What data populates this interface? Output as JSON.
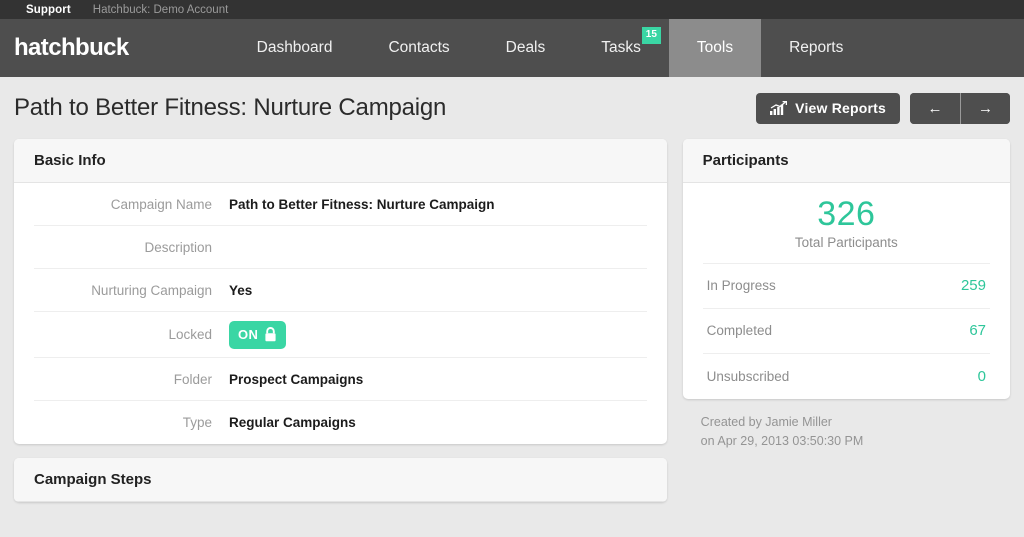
{
  "topbar": {
    "support_label": "Support",
    "account_label": "Hatchbuck: Demo Account"
  },
  "nav": {
    "logo": "hatchbuck",
    "tabs": [
      {
        "label": "Dashboard",
        "active": false,
        "badge": ""
      },
      {
        "label": "Contacts",
        "active": false,
        "badge": ""
      },
      {
        "label": "Deals",
        "active": false,
        "badge": ""
      },
      {
        "label": "Tasks",
        "active": false,
        "badge": "15"
      },
      {
        "label": "Tools",
        "active": true,
        "badge": ""
      },
      {
        "label": "Reports",
        "active": false,
        "badge": ""
      }
    ],
    "badge_color": "#3ad6a4",
    "active_tab_color": "#8c8c8c"
  },
  "page": {
    "title": "Path to Better Fitness:  Nurture Campaign",
    "view_reports_label": "View Reports",
    "prev_arrow": "←",
    "next_arrow": "→"
  },
  "basic_info": {
    "header": "Basic Info",
    "rows": [
      {
        "label": "Campaign Name",
        "value": "Path to Better Fitness:  Nurture Campaign"
      },
      {
        "label": "Description",
        "value": ""
      },
      {
        "label": "Nurturing Campaign",
        "value": "Yes"
      },
      {
        "label": "Locked",
        "value": "ON"
      },
      {
        "label": "Folder",
        "value": "Prospect Campaigns"
      },
      {
        "label": "Type",
        "value": "Regular Campaigns"
      }
    ],
    "locked_toggle_label": "ON",
    "locked_toggle_color": "#3ad6a4"
  },
  "campaign_steps": {
    "header": "Campaign Steps"
  },
  "participants": {
    "header": "Participants",
    "total_value": "326",
    "total_label": "Total Participants",
    "accent_color": "#2ec69a",
    "stats": [
      {
        "name": "In Progress",
        "value": "259"
      },
      {
        "name": "Completed",
        "value": "67"
      },
      {
        "name": "Unsubscribed",
        "value": "0"
      }
    ],
    "created_by_line": "Created by Jamie Miller",
    "created_on_line": "on Apr 29, 2013 03:50:30 PM"
  }
}
